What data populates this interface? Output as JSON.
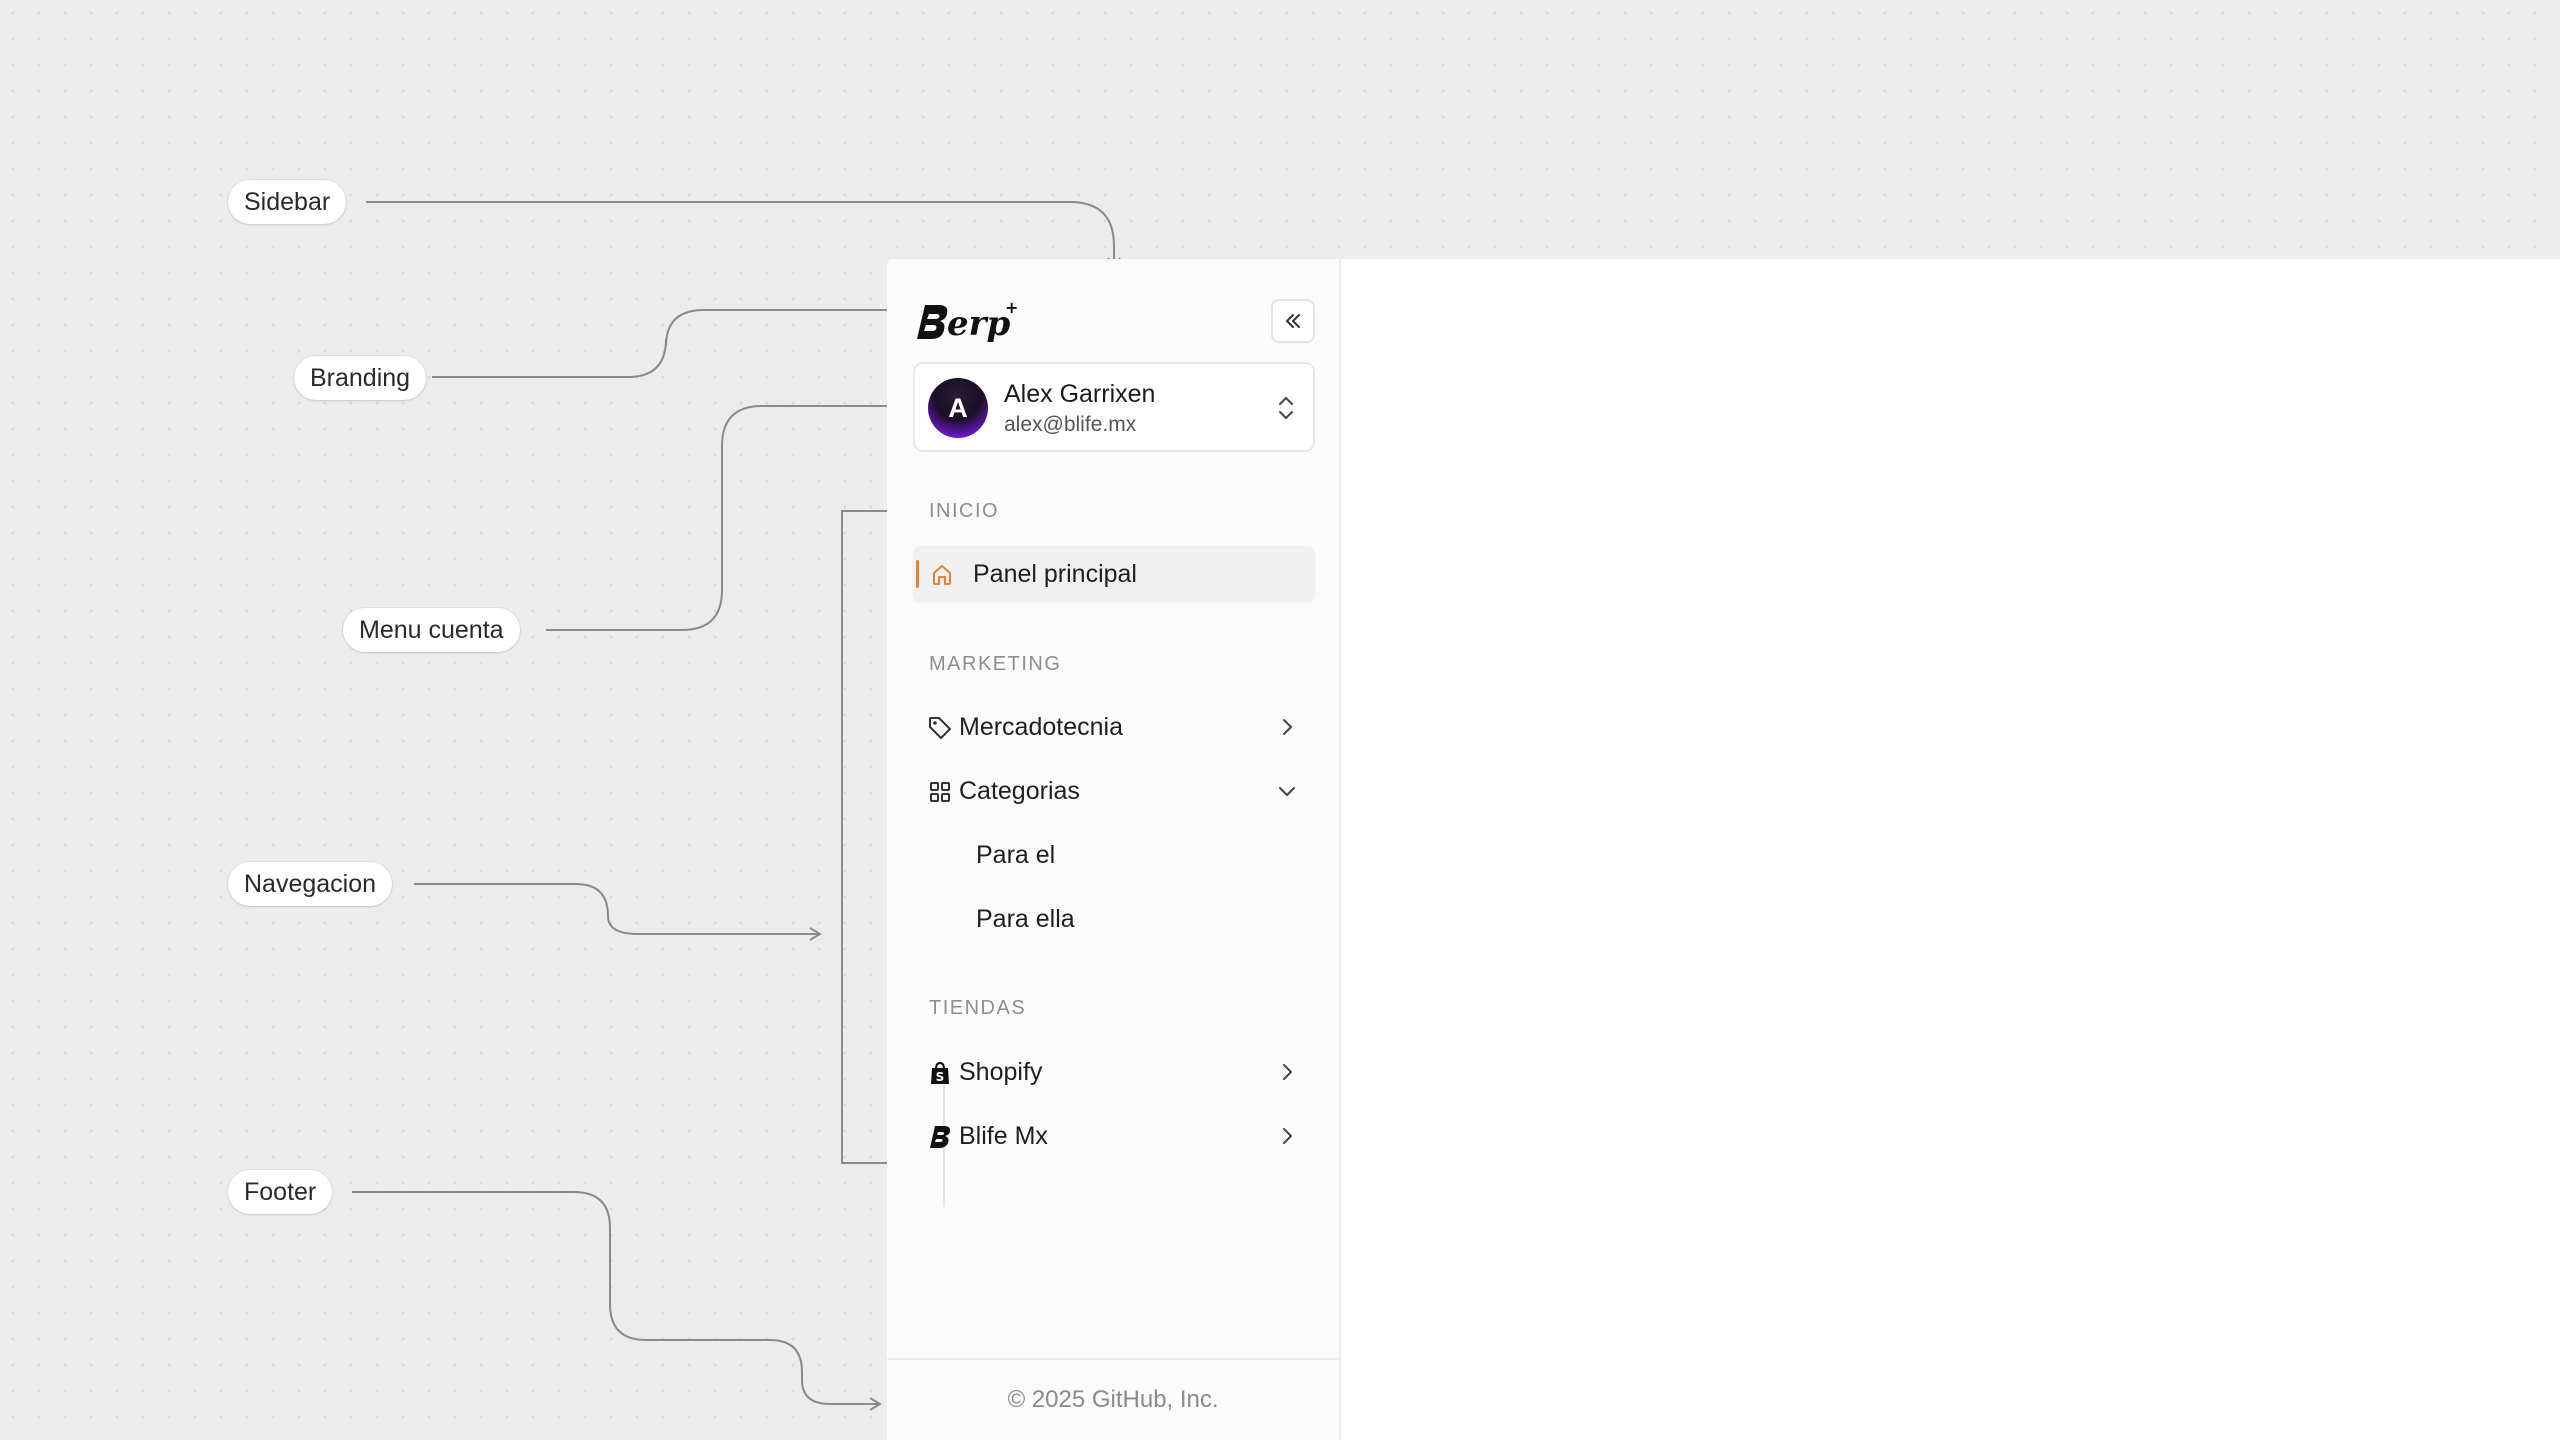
{
  "callouts": {
    "sidebar": "Sidebar",
    "branding": "Branding",
    "menu_cuenta": "Menu cuenta",
    "navegacion": "Navegacion",
    "footer": "Footer"
  },
  "brand": {
    "name": "Berp",
    "suffix": "+"
  },
  "account": {
    "avatar_initial": "A",
    "name": "Alex Garrixen",
    "email": "alex@blife.mx"
  },
  "nav": {
    "inicio": {
      "label": "INICIO",
      "items": [
        {
          "label": "Panel principal",
          "icon": "home-icon",
          "active": true
        }
      ]
    },
    "marketing": {
      "label": "MARKETING",
      "items": [
        {
          "label": "Mercadotecnia",
          "icon": "tag-icon",
          "expanded": false
        },
        {
          "label": "Categorias",
          "icon": "grid-icon",
          "expanded": true,
          "children": [
            {
              "label": "Para el"
            },
            {
              "label": "Para ella"
            }
          ]
        }
      ]
    },
    "tiendas": {
      "label": "TIENDAS",
      "items": [
        {
          "label": "Shopify",
          "icon": "shopify-icon"
        },
        {
          "label": "Blife Mx",
          "icon": "blife-icon"
        }
      ]
    }
  },
  "footer": {
    "text": "© 2025 GitHub, Inc."
  },
  "colors": {
    "accent": "#e8822f",
    "background": "#ececec",
    "sidebar": "#fbfbfb",
    "avatar_gradient": "#6c18c9"
  }
}
